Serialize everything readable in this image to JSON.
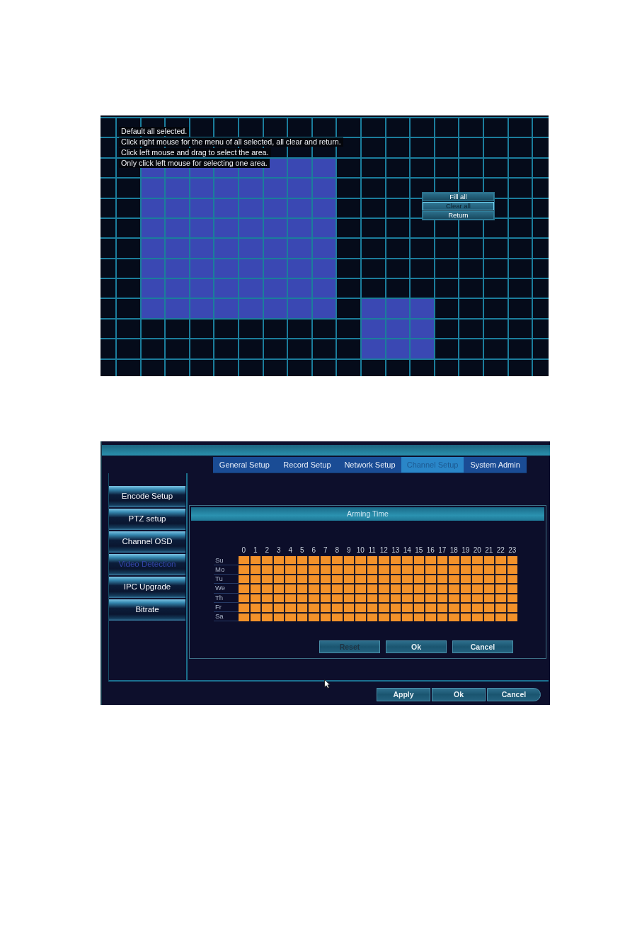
{
  "motion_area": {
    "hints": [
      "Default all selected.",
      "Click right mouse for the menu of all selected, all clear and return.",
      "Click left mouse and drag to select the area.",
      "Only click left mouse for selecting one area."
    ],
    "selected": [
      [
        false,
        false,
        false,
        false,
        false,
        false,
        false,
        false,
        false,
        false,
        false,
        false,
        false,
        false,
        false,
        false,
        false,
        false,
        false
      ],
      [
        false,
        false,
        false,
        false,
        false,
        false,
        false,
        false,
        false,
        false,
        false,
        false,
        false,
        false,
        false,
        false,
        false,
        false,
        false
      ],
      [
        false,
        false,
        true,
        true,
        true,
        true,
        true,
        true,
        true,
        true,
        false,
        false,
        false,
        false,
        false,
        false,
        false,
        false,
        false
      ],
      [
        false,
        false,
        true,
        true,
        true,
        true,
        true,
        true,
        true,
        true,
        false,
        false,
        false,
        false,
        false,
        false,
        false,
        false,
        false
      ],
      [
        false,
        false,
        true,
        true,
        true,
        true,
        true,
        true,
        true,
        true,
        false,
        false,
        false,
        false,
        false,
        false,
        false
      ],
      [
        false,
        false,
        true,
        true,
        true,
        true,
        true,
        true,
        true,
        true,
        false,
        false,
        false,
        false,
        false,
        false,
        false,
        false,
        false
      ],
      [
        false,
        false,
        true,
        true,
        true,
        true,
        true,
        true,
        true,
        true,
        false,
        false,
        false,
        false,
        false,
        false,
        false,
        false,
        false
      ],
      [
        false,
        false,
        true,
        true,
        true,
        true,
        true,
        true,
        true,
        true,
        false,
        false,
        false,
        false,
        false,
        false,
        false,
        false,
        false
      ],
      [
        false,
        false,
        true,
        true,
        true,
        true,
        true,
        true,
        true,
        true,
        false,
        false,
        false,
        false,
        false,
        false,
        false,
        false,
        false
      ],
      [
        false,
        false,
        true,
        true,
        true,
        true,
        true,
        true,
        true,
        true,
        false,
        true,
        true,
        true,
        false,
        false,
        false,
        false,
        false
      ],
      [
        false,
        false,
        false,
        false,
        false,
        false,
        false,
        false,
        false,
        false,
        false,
        true,
        true,
        true,
        false,
        false,
        false,
        false,
        false
      ],
      [
        false,
        false,
        false,
        false,
        false,
        false,
        false,
        false,
        false,
        false,
        false,
        true,
        true,
        true,
        false,
        false,
        false,
        false,
        false
      ],
      [
        false,
        false,
        false,
        false,
        false,
        false,
        false,
        false,
        false,
        false,
        false,
        false,
        false,
        false,
        false,
        false,
        false,
        false,
        false
      ]
    ],
    "context_menu": [
      {
        "label": "Fill all",
        "selected": false
      },
      {
        "label": "Clear all",
        "selected": true
      },
      {
        "label": "Return",
        "selected": false
      }
    ]
  },
  "settings_window": {
    "tabs": [
      {
        "label": "General Setup",
        "selected": false
      },
      {
        "label": "Record Setup",
        "selected": false
      },
      {
        "label": "Network Setup",
        "selected": false
      },
      {
        "label": "Channel Setup",
        "selected": true
      },
      {
        "label": "System Admin",
        "selected": false
      }
    ],
    "sidebar": [
      {
        "label": "Encode Setup",
        "selected": false
      },
      {
        "label": "PTZ setup",
        "selected": false
      },
      {
        "label": "Channel OSD",
        "selected": false
      },
      {
        "label": "Video Detection",
        "selected": true
      },
      {
        "label": "IPC Upgrade",
        "selected": false
      },
      {
        "label": "Bitrate",
        "selected": false
      }
    ],
    "arming_dialog": {
      "title": "Arming Time",
      "hours": [
        "0",
        "1",
        "2",
        "3",
        "4",
        "5",
        "6",
        "7",
        "8",
        "9",
        "10",
        "11",
        "12",
        "13",
        "14",
        "15",
        "16",
        "17",
        "18",
        "19",
        "20",
        "21",
        "22",
        "23"
      ],
      "days": [
        {
          "label": "Su",
          "armed": [
            true,
            true,
            true,
            true,
            true,
            true,
            true,
            true,
            true,
            true,
            true,
            true,
            true,
            true,
            true,
            true,
            true,
            true,
            true,
            true,
            true,
            true,
            true,
            true
          ]
        },
        {
          "label": "Mo",
          "armed": [
            true,
            true,
            true,
            true,
            true,
            true,
            true,
            true,
            true,
            true,
            true,
            true,
            true,
            true,
            true,
            true,
            true,
            true,
            true,
            true,
            true,
            true,
            true,
            true
          ]
        },
        {
          "label": "Tu",
          "armed": [
            true,
            true,
            true,
            true,
            true,
            true,
            true,
            true,
            true,
            true,
            true,
            true,
            true,
            true,
            true,
            true,
            true,
            true,
            true,
            true,
            true,
            true,
            true,
            true
          ]
        },
        {
          "label": "We",
          "armed": [
            true,
            true,
            true,
            true,
            true,
            true,
            true,
            true,
            true,
            true,
            true,
            true,
            true,
            true,
            true,
            true,
            true,
            true,
            true,
            true,
            true,
            true,
            true,
            true
          ]
        },
        {
          "label": "Th",
          "armed": [
            true,
            true,
            true,
            true,
            true,
            true,
            true,
            true,
            true,
            true,
            true,
            true,
            true,
            true,
            true,
            true,
            true,
            true,
            true,
            true,
            true,
            true,
            true,
            true
          ]
        },
        {
          "label": "Fr",
          "armed": [
            true,
            true,
            true,
            true,
            true,
            true,
            true,
            true,
            true,
            true,
            true,
            true,
            true,
            true,
            true,
            true,
            true,
            true,
            true,
            true,
            true,
            true,
            true,
            true
          ]
        },
        {
          "label": "Sa",
          "armed": [
            true,
            true,
            true,
            true,
            true,
            true,
            true,
            true,
            true,
            true,
            true,
            true,
            true,
            true,
            true,
            true,
            true,
            true,
            true,
            true,
            true,
            true,
            true,
            true
          ]
        }
      ],
      "buttons": [
        {
          "label": "Reset",
          "disabled": true
        },
        {
          "label": "Ok",
          "disabled": false
        },
        {
          "label": "Cancel",
          "disabled": false
        }
      ]
    },
    "buttons": [
      "Apply",
      "Ok",
      "Cancel"
    ]
  }
}
